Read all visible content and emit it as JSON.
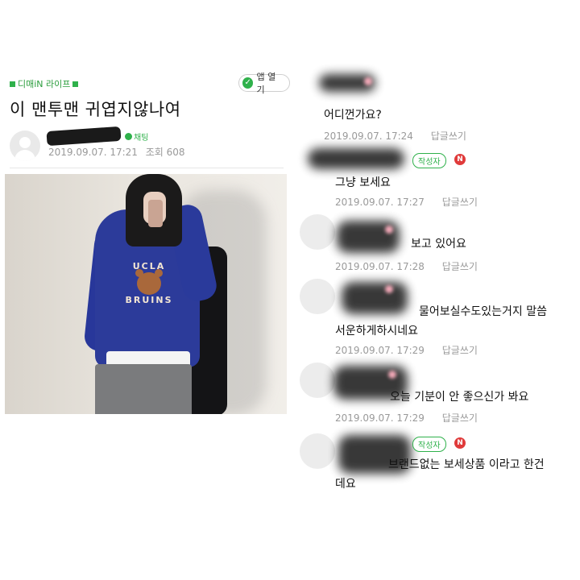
{
  "post": {
    "cafe_label": "디매iN 라이프",
    "app_button": "앱 열기",
    "title": "이 맨투맨 귀엽지않나여",
    "chat_label": "채팅",
    "date": "2019.09.07. 17:21",
    "views": "조회 608"
  },
  "comments": [
    {
      "text": "어디껀가요?",
      "date": "2019.09.07. 17:24",
      "reply": "답글쓰기",
      "is_author": false
    },
    {
      "text": "그냥 보세요",
      "date": "2019.09.07. 17:27",
      "reply": "답글쓰기",
      "is_author": true
    },
    {
      "text": "보고 있어요",
      "date": "2019.09.07. 17:28",
      "reply": "답글쓰기",
      "is_author": false
    },
    {
      "text": "물어보실수도있는거지 말씀",
      "text2": "서운하게하시네요",
      "date": "2019.09.07. 17:29",
      "reply": "답글쓰기",
      "is_author": false
    },
    {
      "text": "오늘 기분이 안 좋으신가 봐요",
      "date": "2019.09.07. 17:29",
      "reply": "답글쓰기",
      "is_author": false
    },
    {
      "text": "브랜드없는 보세상품 이라고 한건",
      "text2": "데요",
      "is_author": true
    }
  ],
  "badges": {
    "author": "작성자",
    "new": "N"
  },
  "photo_print": {
    "top": "UCLA",
    "bottom": "BRUINS"
  }
}
